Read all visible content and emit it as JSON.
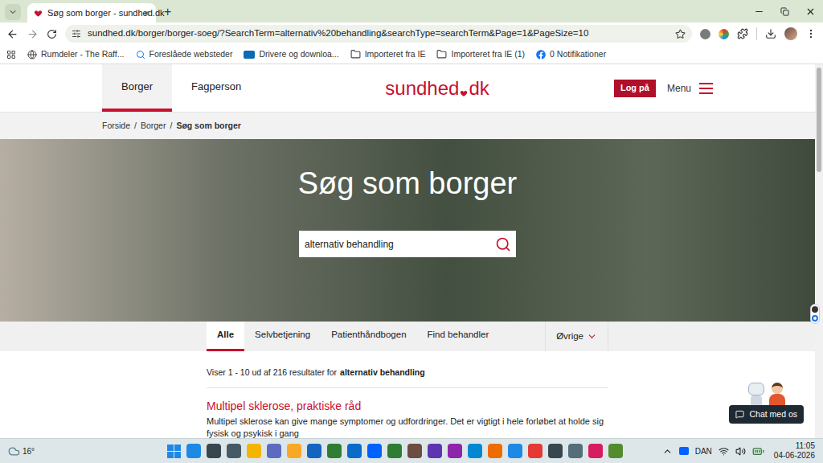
{
  "browser": {
    "tab": {
      "title": "Søg som borger - sundhed.dk",
      "close": "×"
    },
    "new_tab": "+",
    "url": "sundhed.dk/borger/borger-soeg/?SearchTerm=alternativ%20behandling&searchType=searchTerm&Page=1&PageSize=10",
    "bookmarks": [
      {
        "label": "Rumdeler - The Raff...",
        "kind": "site"
      },
      {
        "label": "Foreslåede websteder",
        "kind": "search"
      },
      {
        "label": "Drivere og downloa...",
        "kind": "dell"
      },
      {
        "label": "Importeret fra IE",
        "kind": "folder"
      },
      {
        "label": "Importeret fra IE (1)",
        "kind": "folder"
      },
      {
        "label": "0 Notifikationer",
        "kind": "facebook"
      }
    ]
  },
  "header": {
    "nav": [
      {
        "label": "Borger",
        "selected": true
      },
      {
        "label": "Fagperson",
        "selected": false
      }
    ],
    "logo": {
      "left": "sundhed",
      "right": "dk"
    },
    "login": "Log på",
    "menu": "Menu"
  },
  "breadcrumb": {
    "separator": "/",
    "items": [
      {
        "label": "Forside",
        "current": false
      },
      {
        "label": "Borger",
        "current": false
      },
      {
        "label": "Søg som borger",
        "current": true
      }
    ]
  },
  "hero": {
    "title": "Søg som borger",
    "search_value": "alternativ behandling"
  },
  "tabs": [
    {
      "label": "Alle",
      "selected": true
    },
    {
      "label": "Selvbetjening",
      "selected": false
    },
    {
      "label": "Patienthåndbogen",
      "selected": false
    },
    {
      "label": "Find behandler",
      "selected": false
    }
  ],
  "more_tab": {
    "label": "Øvrige",
    "expanded": false
  },
  "results": {
    "summary": "Viser 1 - 10 ud af 216 resultater for",
    "term": "alternativ behandling",
    "items": [
      {
        "title": "Multipel sklerose, praktiske råd",
        "description": "Multipel sklerose kan give mange symptomer og udfordringer. Det er vigtigt i hele forløbet at holde sig fysisk og psykisk i gang"
      }
    ]
  },
  "chat": {
    "label": "Chat med os"
  },
  "taskbar": {
    "temperature": "16°",
    "language": "DAN",
    "time": "11:05",
    "date": "04-06-2026"
  }
}
